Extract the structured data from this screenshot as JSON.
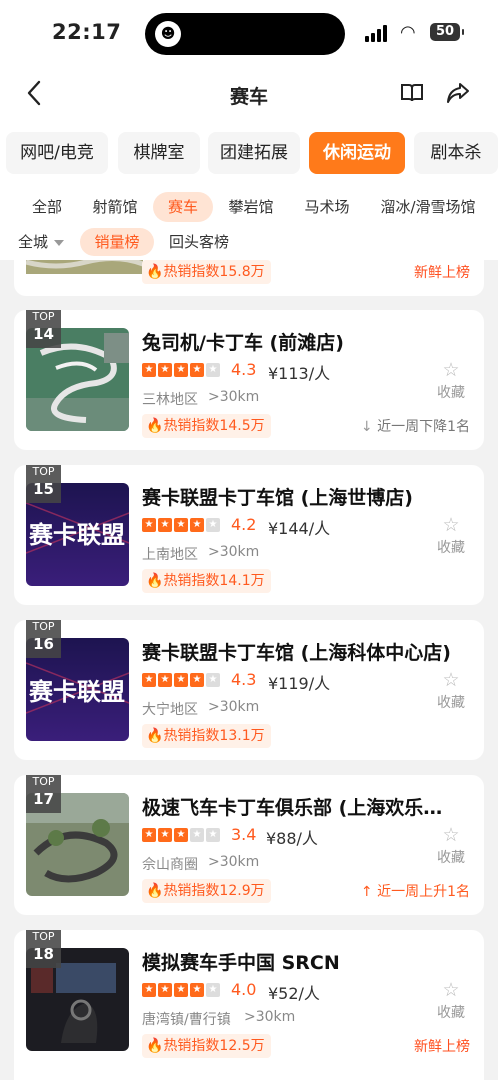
{
  "status_bar": {
    "time": "22:17",
    "battery": "50"
  },
  "nav": {
    "title": "赛车",
    "back_icon": "chevron-left-icon",
    "book_icon": "book-icon",
    "share_icon": "share-icon"
  },
  "categories": [
    {
      "label": "网吧/电竞"
    },
    {
      "label": "棋牌室"
    },
    {
      "label": "团建拓展"
    },
    {
      "label": "休闲运动",
      "active": true
    },
    {
      "label": "剧本杀"
    }
  ],
  "subcategories": [
    {
      "label": "全部"
    },
    {
      "label": "射箭馆"
    },
    {
      "label": "赛车",
      "active": true
    },
    {
      "label": "攀岩馆"
    },
    {
      "label": "马术场"
    },
    {
      "label": "溜冰/滑雪场馆"
    }
  ],
  "filters": {
    "city": "全城",
    "sales": "销量榜",
    "repeat": "回头客榜"
  },
  "accent_color": "#ff7a1a",
  "prev_item": {
    "hot_index": "热销指数15.8万",
    "trend": "新鲜上榜"
  },
  "items": [
    {
      "top_label": "TOP",
      "rank": "14",
      "name": "兔司机/卡丁车 (前滩店)",
      "rating": 4,
      "score": "4.3",
      "price": "¥113/人",
      "area": "三林地区",
      "distance": ">30km",
      "hot_index": "热销指数14.5万",
      "fav": "收藏",
      "trend": "近一周下降1名",
      "trend_type": "down"
    },
    {
      "top_label": "TOP",
      "rank": "15",
      "name": "赛卡联盟卡丁车馆 (上海世博店)",
      "rating": 4,
      "score": "4.2",
      "price": "¥144/人",
      "area": "上南地区",
      "distance": ">30km",
      "hot_index": "热销指数14.1万",
      "fav": "收藏",
      "trend": "",
      "trend_type": "none"
    },
    {
      "top_label": "TOP",
      "rank": "16",
      "name": "赛卡联盟卡丁车馆 (上海科体中心店)",
      "rating": 4,
      "score": "4.3",
      "price": "¥119/人",
      "area": "大宁地区",
      "distance": ">30km",
      "hot_index": "热销指数13.1万",
      "fav": "收藏",
      "trend": "",
      "trend_type": "none"
    },
    {
      "top_label": "TOP",
      "rank": "17",
      "name": "极速飞车卡丁车俱乐部 (上海欢乐…",
      "rating": 3,
      "score": "3.4",
      "price": "¥88/人",
      "area": "佘山商圈",
      "distance": ">30km",
      "hot_index": "热销指数12.9万",
      "fav": "收藏",
      "trend": "近一周上升1名",
      "trend_type": "up"
    },
    {
      "top_label": "TOP",
      "rank": "18",
      "name": "模拟赛车手中国 SRCN",
      "rating": 4,
      "score": "4.0",
      "price": "¥52/人",
      "area": "唐湾镇/曹行镇",
      "distance": ">30km",
      "hot_index": "热销指数12.5万",
      "fav": "收藏",
      "trend": "新鲜上榜",
      "trend_type": "new"
    }
  ]
}
